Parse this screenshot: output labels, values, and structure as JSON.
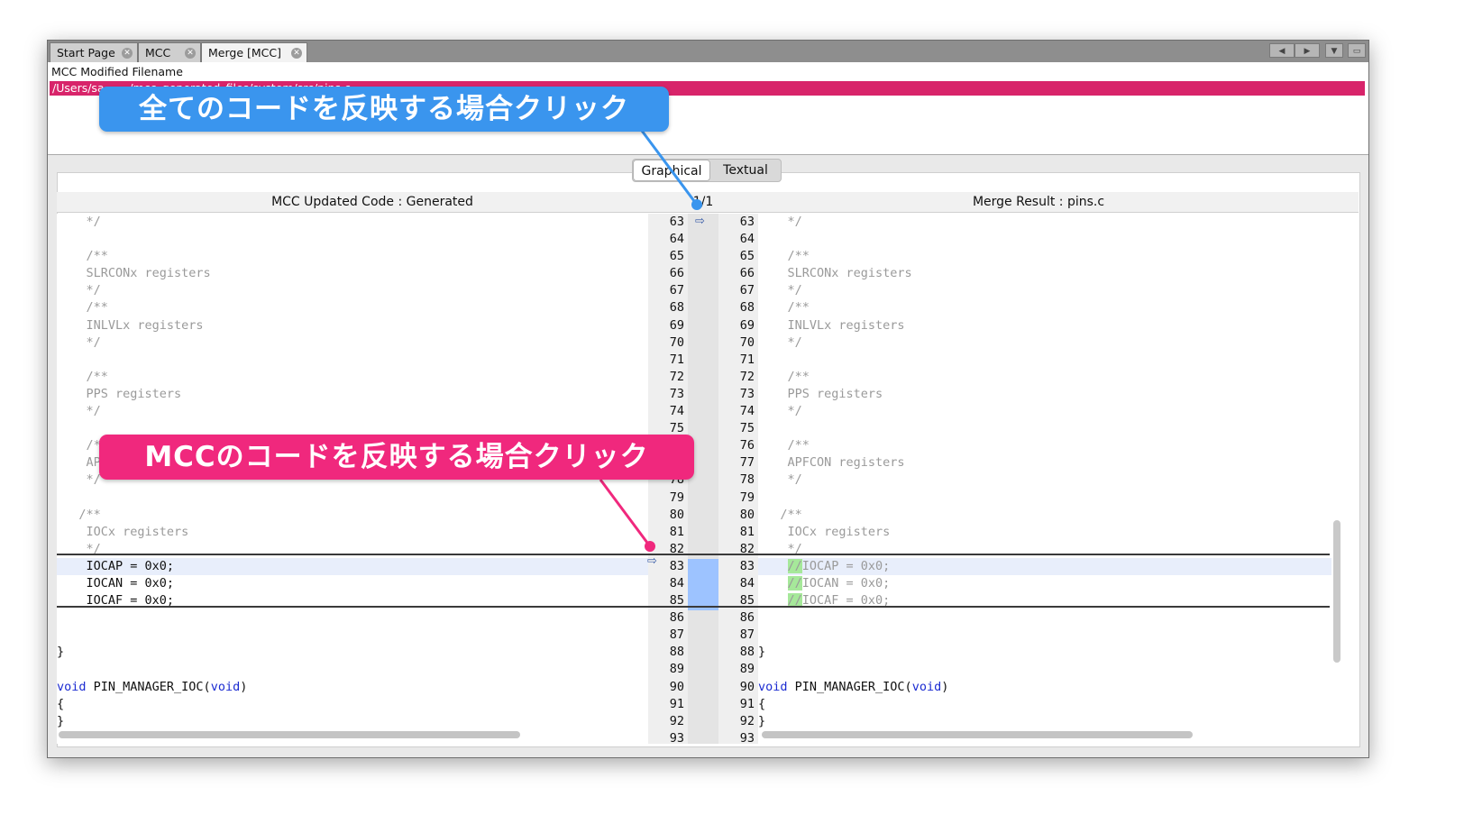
{
  "tabs": [
    {
      "label": "Start Page"
    },
    {
      "label": "MCC"
    },
    {
      "label": "Merge [MCC]"
    }
  ],
  "file_panel": {
    "label": "MCC Modified Filename",
    "path": "/Users/sa...  .../mcc_generated_files/system/src/pins.c"
  },
  "view_toggle": {
    "graphical": "Graphical",
    "textual": "Textual"
  },
  "columns": {
    "left": "MCC Updated Code : Generated",
    "center": "1/1",
    "right": "Merge Result : pins.c"
  },
  "callouts": {
    "all": "全てのコードを反映する場合クリック",
    "mcc": "MCCのコードを反映する場合クリック"
  },
  "line_numbers": [
    "63",
    "64",
    "65",
    "66",
    "67",
    "68",
    "69",
    "70",
    "71",
    "72",
    "73",
    "74",
    "75",
    "76",
    "77",
    "78",
    "79",
    "80",
    "81",
    "82",
    "83",
    "84",
    "85",
    "86",
    "87",
    "88",
    "89",
    "90",
    "91",
    "92",
    "93"
  ],
  "left_code": [
    "    */",
    "",
    "    /**",
    "    SLRCONx registers",
    "    */",
    "    /**",
    "    INLVLx registers",
    "    */",
    "",
    "    /**",
    "    PPS registers",
    "    */",
    "",
    "    /**",
    "    APFCON registers",
    "    */",
    "",
    "   /**",
    "    IOCx registers",
    "    */",
    "    IOCAP = 0x0;",
    "    IOCAN = 0x0;",
    "    IOCAF = 0x0;",
    "",
    "",
    "}",
    "",
    "void PIN_MANAGER_IOC(void)",
    "{",
    "}",
    ""
  ],
  "right_code": [
    "    */",
    "",
    "    /**",
    "    SLRCONx registers",
    "    */",
    "    /**",
    "    INLVLx registers",
    "    */",
    "",
    "    /**",
    "    PPS registers",
    "    */",
    "",
    "    /**",
    "    APFCON registers",
    "    */",
    "",
    "   /**",
    "    IOCx registers",
    "    */",
    "    //IOCAP = 0x0;",
    "    //IOCAN = 0x0;",
    "    //IOCAF = 0x0;",
    "",
    "",
    "}",
    "",
    "void PIN_MANAGER_IOC(void)",
    "{",
    "}",
    ""
  ],
  "colors": {
    "path_highlight": "#d8246a",
    "callout_blue": "#3a95ee",
    "callout_pink": "#f0287d",
    "change_block": "#9dc3ff",
    "keyword": "#1b2bd1"
  }
}
